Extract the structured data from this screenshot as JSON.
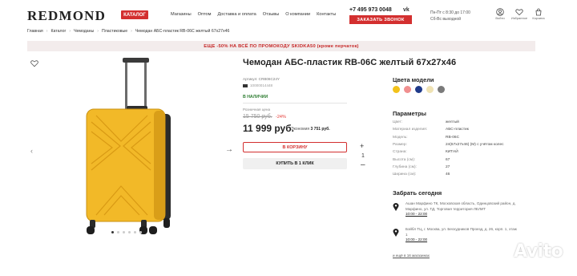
{
  "header": {
    "logo": "REDMOND",
    "catalog_label": "КАТАЛОГ",
    "nav": [
      "Магазины",
      "Оптом",
      "Доставка и оплата",
      "Отзывы",
      "О компании",
      "Контакты"
    ],
    "phone": "+7 495 973 0048",
    "vk_label": "vk",
    "call_button": "ЗАКАЗАТЬ ЗВОНОК",
    "hours_line1": "Пн-Пт с 8:30 до 17:00",
    "hours_line2": "Сб-Вс выходной",
    "icons": [
      {
        "name": "profile-icon",
        "label": "Войти"
      },
      {
        "name": "favorites-icon",
        "label": "Избранное"
      },
      {
        "name": "cart-icon",
        "label": "Корзина"
      }
    ]
  },
  "breadcrumb": [
    "Главная",
    "Каталог",
    "Чемоданы",
    "Пластиковые",
    "Чемодан АБС-пластик RB-06C желтый 67х27х46"
  ],
  "promo": "ЕЩЕ -50% НА ВСЁ ПО ПРОМОКОДУ SKIDKA50 (кроме перчаток)",
  "product": {
    "title": "Чемодан АБС-пластик RB-06C желтый 67х27х46",
    "article": "Артикул: CRB06C24Y",
    "barcode": "10000014448",
    "stock": "В НАЛИЧИИ",
    "retail_label": "Розничная цена",
    "old_price": "15 750 руб.",
    "discount": "-24%",
    "price": "11 999 руб.",
    "economy_label": "Экономия",
    "economy_value": "3 751 руб.",
    "cart_button": "В КОРЗИНУ",
    "buy_one_click": "КУПИТЬ В 1 КЛИК",
    "qty_plus": "+",
    "qty": "1",
    "qty_minus": "–",
    "image_count": 6,
    "active_image": 0
  },
  "colors": {
    "title": "Цвета модели",
    "swatches": [
      "#f2c21a",
      "#f08f8f",
      "#1f3a8a",
      "#efe2b3",
      "#7a7a7a"
    ]
  },
  "params": {
    "title": "Параметры",
    "rows": [
      {
        "k": "Цвет:",
        "v": "желтый"
      },
      {
        "k": "Материал изделия:",
        "v": "АБС-пластик"
      },
      {
        "k": "Модель:",
        "v": "RB-06C"
      },
      {
        "k": "Размер:",
        "v": "24(67х27х46) (М) с учётом колес"
      },
      {
        "k": "Страна:",
        "v": "КИТАЙ"
      },
      {
        "k": "Высота (см):",
        "v": "67"
      },
      {
        "k": "Глубина (см):",
        "v": "27"
      },
      {
        "k": "Ширина (см):",
        "v": "46"
      }
    ]
  },
  "pickup": {
    "title": "Забрать сегодня",
    "stores": [
      {
        "line1": "Ашан Марфино ТК, Московская область, Одинцовский район, д.",
        "line2": "Марфино, ул. ТД, Торговая территория ЛЕЛИТ",
        "time": "10:00 - 22:00"
      },
      {
        "line1": "Бэйбл ТЦ, г. Москва, ул. Бескудников Проезд, д. 26, корп. 1, этаж",
        "line2": "1",
        "time": "10:00 - 22:00"
      }
    ],
    "more": "и ещё в 16 магазинах"
  },
  "watermark": "Avito",
  "accent": "#d32f2f"
}
